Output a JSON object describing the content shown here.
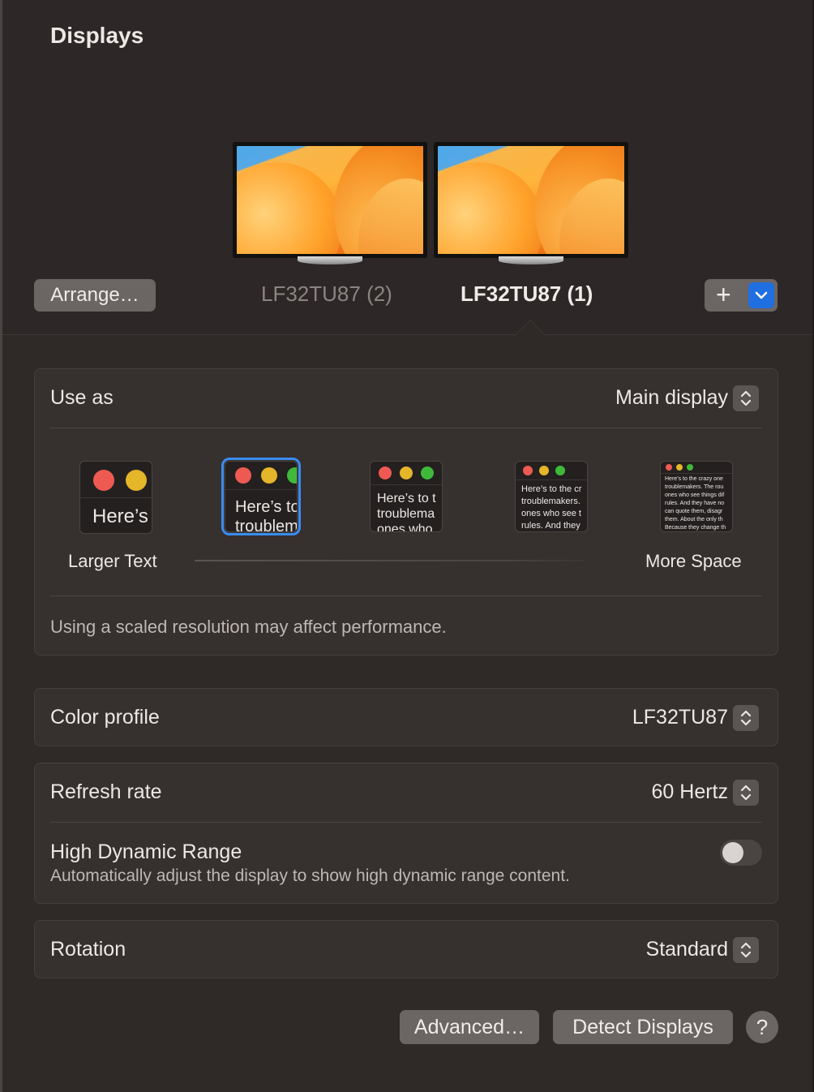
{
  "window": {
    "title": "Displays"
  },
  "displays": [
    {
      "label": "LF32TU87 (2)",
      "selected": false
    },
    {
      "label": "LF32TU87 (1)",
      "selected": true
    }
  ],
  "toolbar": {
    "arrange_label": "Arrange…",
    "add_label": "+"
  },
  "use_as": {
    "label": "Use as",
    "value": "Main display"
  },
  "resolution": {
    "options": [
      {
        "preview_text": "Here’s",
        "selected": false
      },
      {
        "preview_text": "Here’s to\ntroublem",
        "selected": true
      },
      {
        "preview_text": "Here’s to t\ntroublema\nones who",
        "selected": false
      },
      {
        "preview_text": "Here’s to the cr\ntroublemakers.\nones who see t\nrules. And they",
        "selected": false
      },
      {
        "preview_text": "Here’s to the crazy one\ntroublemakers. The rou\nones who see things dif\nrules. And they have no\ncan quote them, disagr\nthem. About the only th\nBecause they change th",
        "selected": false
      }
    ],
    "larger_label": "Larger Text",
    "more_label": "More Space",
    "note": "Using a scaled resolution may affect performance."
  },
  "color_profile": {
    "label": "Color profile",
    "value": "LF32TU87"
  },
  "refresh_rate": {
    "label": "Refresh rate",
    "value": "60 Hertz"
  },
  "hdr": {
    "label": "High Dynamic Range",
    "description": "Automatically adjust the display to show high dynamic range content.",
    "enabled": false
  },
  "rotation": {
    "label": "Rotation",
    "value": "Standard"
  },
  "footer": {
    "advanced_label": "Advanced…",
    "detect_label": "Detect Displays",
    "help_label": "?"
  },
  "colors": {
    "accent": "#1f6fe0",
    "traffic_red": "#ee5a52",
    "traffic_yellow": "#e5b52a",
    "traffic_green": "#3fb93a"
  }
}
